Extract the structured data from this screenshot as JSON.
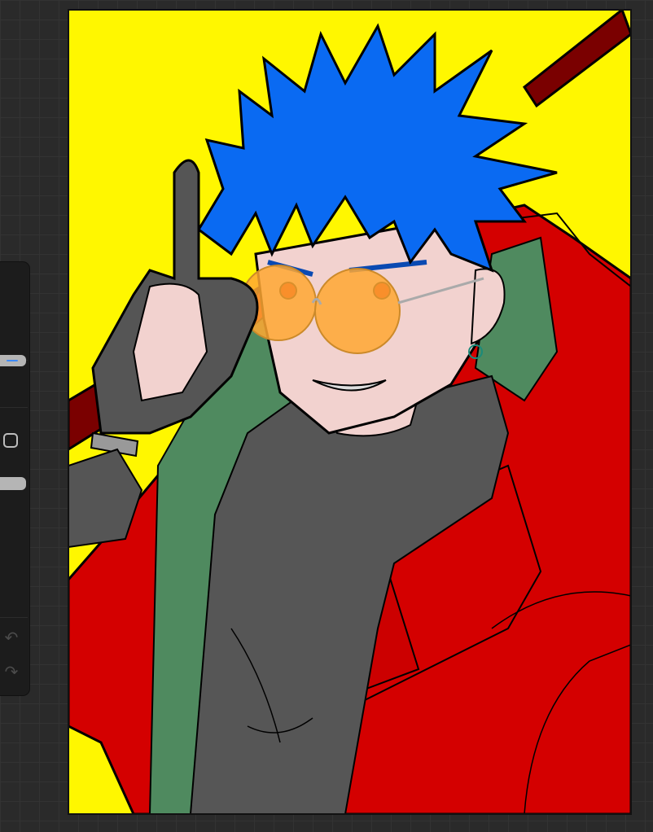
{
  "app": {
    "name": ""
  },
  "sidebar": {
    "tools": [
      {
        "name": "brush-size-slider"
      },
      {
        "name": "modifier-button"
      },
      {
        "name": "opacity-slider"
      },
      {
        "name": "undo-button"
      },
      {
        "name": "redo-button"
      }
    ],
    "icons": {
      "undo": "undo-icon",
      "redo": "redo-icon"
    }
  },
  "canvas": {
    "artwork": "illustration",
    "colors": {
      "background": "#fff700",
      "hair": "#0a6af2",
      "jacket": "#d40000",
      "lining": "#4f8a5f",
      "shirt": "#565656",
      "skin": "#f2d2cf",
      "lens": "#ffa833",
      "staff": "#7a0000",
      "glove": "#555555"
    }
  }
}
